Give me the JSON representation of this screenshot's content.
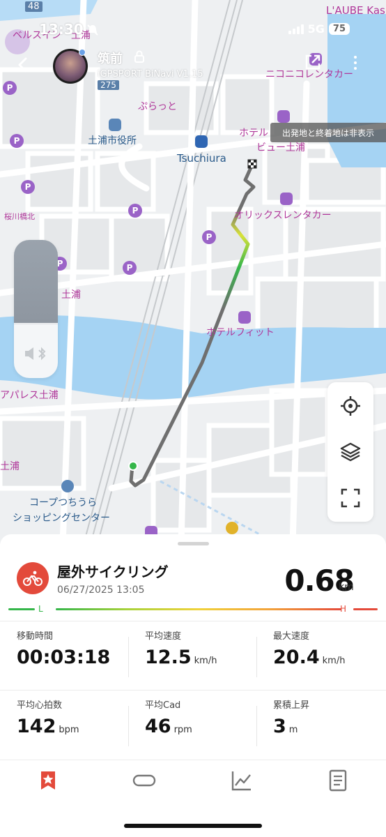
{
  "status_bar": {
    "time": "13:30",
    "network": "5G",
    "battery": "75"
  },
  "header": {
    "user_name": "筑前",
    "device_name": "iGPSPORT BiNavi V1.15"
  },
  "map": {
    "toast": "出発地と終着地は非表示",
    "labels": {
      "top_number": "48",
      "lauberge": "L'AUBE Kas",
      "bells": "ベルスイン　土浦",
      "route_275": "275",
      "nikoniko": "ニコニコレンタカー",
      "purat": "ぷらっと",
      "city_hall": "土浦市役所",
      "tsuchiura": "Tsuchiura",
      "hotel_view_1": "ホテル",
      "hotel_view_2": "ビュー土浦",
      "orix": "オリックスレンタカー",
      "sakuragawa": "桜川橋北",
      "tsuchiura_left": "土浦",
      "hotel_fit": "ホテルフィット",
      "apparel": "アパレス土浦",
      "tsuchiura_left2": "土浦",
      "coop_1": "コープつちうら",
      "coop_2": "ショッピングセンター"
    },
    "route_colors": {
      "low": "#35b64a",
      "mid": "#f0d23a",
      "high": "#e44a3a",
      "grey": "#777777"
    }
  },
  "volume": {
    "level": 0.6
  },
  "map_controls": {
    "locate": "crosshair-icon",
    "layers": "layers-icon",
    "fullscreen": "fullscreen-icon"
  },
  "activity": {
    "title": "屋外サイクリング",
    "datetime": "06/27/2025 13:05",
    "distance": "0.68",
    "distance_unit": "km",
    "low_label": "L",
    "high_label": "H",
    "accent": "#e34a3b"
  },
  "stats": [
    [
      {
        "label": "移動時間",
        "value": "00:03:18",
        "unit": ""
      },
      {
        "label": "平均速度",
        "value": "12.5",
        "unit": "km/h"
      },
      {
        "label": "最大速度",
        "value": "20.4",
        "unit": "km/h"
      }
    ],
    [
      {
        "label": "平均心拍数",
        "value": "142",
        "unit": "bpm"
      },
      {
        "label": "平均Cad",
        "value": "46",
        "unit": "rpm"
      },
      {
        "label": "累積上昇",
        "value": "3",
        "unit": "m"
      }
    ]
  ],
  "tabs": [
    {
      "name": "summary",
      "icon": "star-bookmark-icon",
      "active": true
    },
    {
      "name": "route",
      "icon": "loop-icon",
      "active": false
    },
    {
      "name": "chart",
      "icon": "chart-icon",
      "active": false
    },
    {
      "name": "details",
      "icon": "document-icon",
      "active": false
    }
  ]
}
